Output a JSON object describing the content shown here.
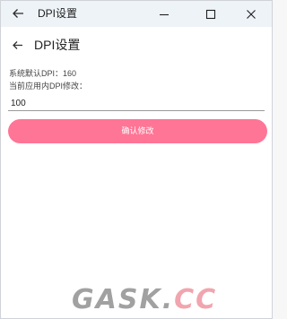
{
  "window": {
    "title": "DPI设置",
    "icons": {
      "back": "arrow-left-icon",
      "minimize": "minimize-icon",
      "maximize": "maximize-icon",
      "close": "close-icon"
    }
  },
  "app_bar": {
    "title": "DPI设置",
    "back_icon": "arrow-left-icon"
  },
  "info": {
    "default_dpi_label": "系统默认DPI：",
    "default_dpi_value": "160",
    "current_dpi_label": "当前应用内DPI修改："
  },
  "input": {
    "value": "100"
  },
  "button": {
    "label": "确认修改",
    "color": "#ff7596"
  },
  "watermark": {
    "part1": "GASK.",
    "part2": "CC",
    "colors": {
      "part1": "#878787",
      "part2": "#ee919c"
    }
  },
  "theme": {
    "titlebar_bg": "#eef3f8",
    "accent": "#ff7596"
  }
}
